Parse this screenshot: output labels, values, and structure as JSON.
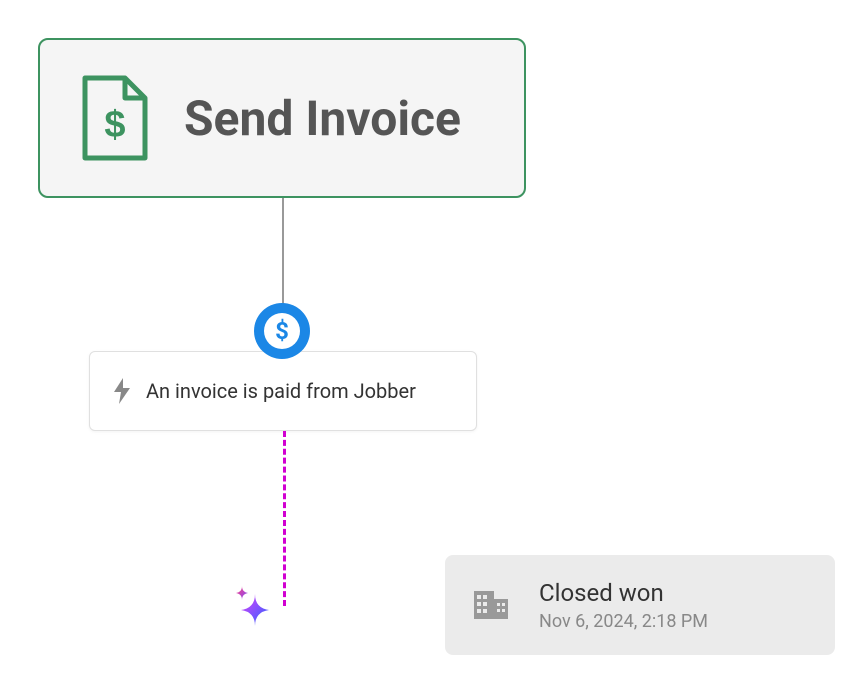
{
  "sendInvoice": {
    "title": "Send Invoice"
  },
  "trigger": {
    "text": "An invoice is paid from Jobber"
  },
  "closedWon": {
    "title": "Closed won",
    "date": "Nov 6, 2024, 2:18 PM"
  },
  "colors": {
    "green": "#3d9360",
    "blue": "#1b87e6",
    "magenta": "#d100d1"
  }
}
